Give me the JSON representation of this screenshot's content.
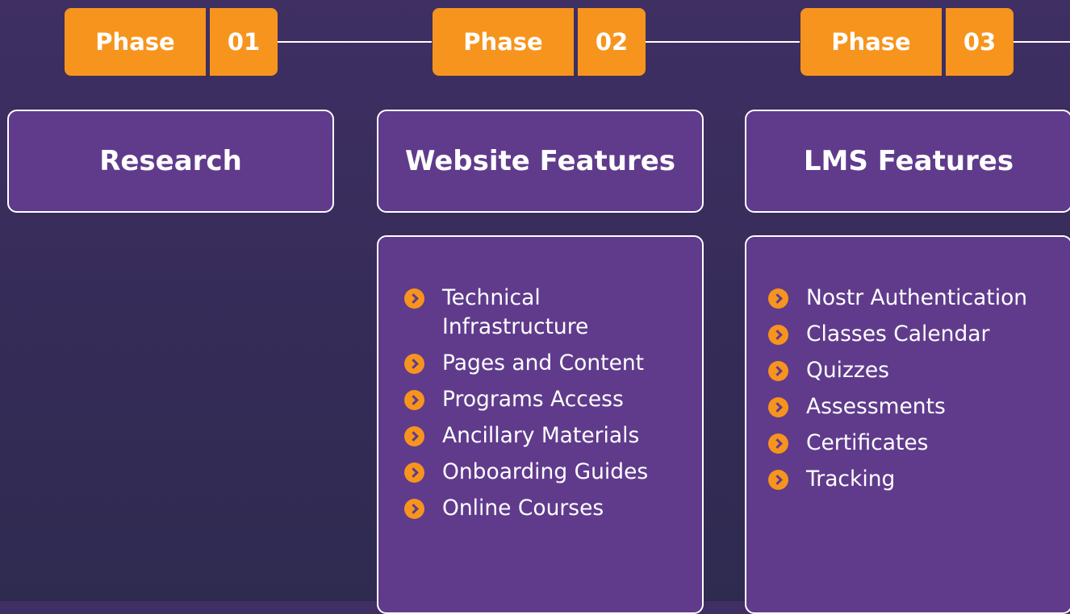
{
  "phases": [
    {
      "label": "Phase",
      "number": "01"
    },
    {
      "label": "Phase",
      "number": "02"
    },
    {
      "label": "Phase",
      "number": "03"
    }
  ],
  "cards": [
    {
      "title": "Research",
      "items": []
    },
    {
      "title": "Website Features",
      "items": [
        "Technical Infrastructure",
        "Pages and Content",
        "Programs Access",
        "Ancillary Materials",
        "Onboarding Guides",
        "Online Courses"
      ]
    },
    {
      "title": "LMS Features",
      "items": [
        "Nostr Authentication",
        "Classes Calendar",
        "Quizzes",
        "Assessments",
        "Certificates",
        "Tracking"
      ]
    }
  ],
  "colors": {
    "accent": "#f7941d",
    "card": "#603b8c",
    "background": "#3a2d5c"
  },
  "icons": {
    "bullet": "chevron-right-circle-icon"
  }
}
